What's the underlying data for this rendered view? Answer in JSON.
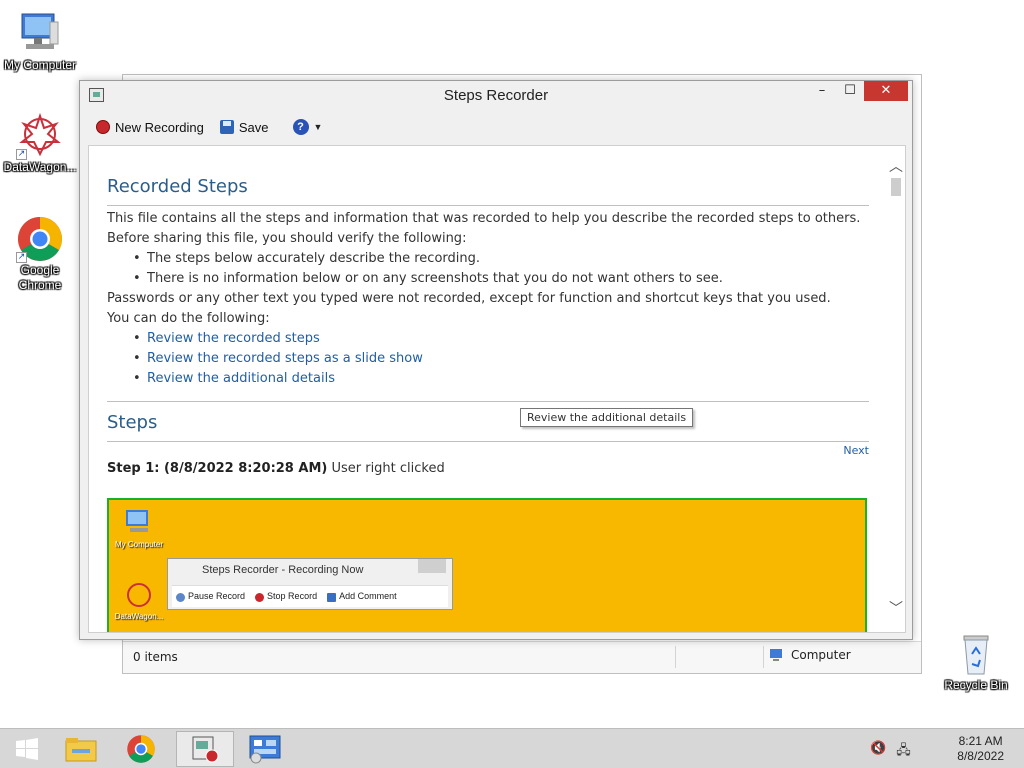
{
  "desktop": {
    "icons": [
      {
        "label": "My Computer"
      },
      {
        "label": "DataWagon..."
      },
      {
        "label": "Google Chrome"
      },
      {
        "label": "Recycle Bin"
      }
    ]
  },
  "bg_window": {
    "status_items": "0 items",
    "status_location": "Computer"
  },
  "window": {
    "title": "Steps Recorder",
    "toolbar": {
      "new_recording": "New Recording",
      "save": "Save",
      "help": "?"
    }
  },
  "doc": {
    "recorded_heading": "Recorded Steps",
    "intro": "This file contains all the steps and information that was recorded to help you describe the recorded steps to others.",
    "verify": "Before sharing this file, you should verify the following:",
    "checks": [
      "The steps below accurately describe the recording.",
      "There is no information below or on any screenshots that you do not want others to see."
    ],
    "passwords": "Passwords or any other text you typed were not recorded, except for function and shortcut keys that you used.",
    "you_can": "You can do the following:",
    "links": [
      "Review the recorded steps",
      "Review the recorded steps as a slide show",
      "Review the additional details"
    ],
    "steps_heading": "Steps",
    "next": "Next",
    "step1_bold": "Step 1: (8/8/2022 8:20:28 AM)",
    "step1_rest": " User right clicked"
  },
  "screenshot": {
    "icon1": "My Computer",
    "icon2": "DataWagon...",
    "window_title": "Steps Recorder - Recording Now",
    "pause": "Pause Record",
    "stop": "Stop Record",
    "comment": "Add Comment"
  },
  "tooltip": "Review the additional details",
  "taskbar": {
    "time": "8:21 AM",
    "date": "8/8/2022"
  },
  "colors": {
    "accent_close": "#c7372f",
    "link": "#1f5ea8",
    "heading": "#2a5d8a",
    "screenshot_bg": "#f8b800"
  }
}
